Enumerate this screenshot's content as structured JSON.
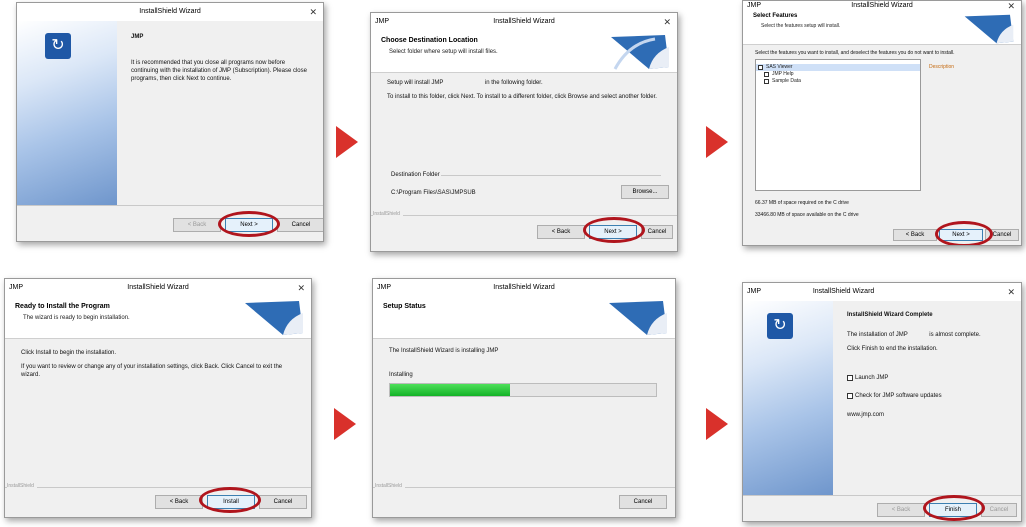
{
  "accent_color": "#d9312b",
  "highlight_color": "#b0151d",
  "progress_fraction": 0.45,
  "dialog1": {
    "title": "InstallShield Wizard",
    "product": "JMP",
    "text": "It is recommended that you close all programs now before continuing with the installation of JMP (Subscription). Please close programs, then click Next to continue.",
    "back": "< Back",
    "next": "Next >",
    "cancel": "Cancel"
  },
  "dialog2": {
    "app": "JMP",
    "title": "InstallShield Wizard",
    "header_title": "Choose Destination Location",
    "header_sub": "Select folder where setup will install files.",
    "line1": "Setup will install JMP",
    "line1b": "in the following folder.",
    "line2": "To install to this folder, click Next. To install to a different folder, click Browse and select another folder.",
    "dest_label": "Destination Folder",
    "dest_path": "C:\\Program Files\\SAS\\JMPSUB",
    "browse": "Browse...",
    "footer": "InstallShield",
    "back": "< Back",
    "next": "Next >",
    "cancel": "Cancel"
  },
  "dialog3": {
    "app": "JMP",
    "title": "InstallShield Wizard",
    "header_title": "Select Features",
    "header_sub": "Select the features setup will install.",
    "instruction": "Select the features you want to install, and deselect the features you do not want to install.",
    "description_label": "Description",
    "features": [
      "SAS Viewer",
      "JMP Help",
      "Sample Data"
    ],
    "space_required": "66.37 MB of space required on the C drive",
    "space_available": "33466.80 MB of space available on the C drive",
    "back": "< Back",
    "next": "Next >",
    "cancel": "Cancel"
  },
  "dialog4": {
    "app": "JMP",
    "title": "InstallShield Wizard",
    "header_title": "Ready to Install the Program",
    "header_sub": "The wizard is ready to begin installation.",
    "line1": "Click Install to begin the installation.",
    "line2": "If you want to review or change any of your installation settings, click Back. Click Cancel to exit the wizard.",
    "footer": "InstallShield",
    "back": "< Back",
    "install": "Install",
    "cancel": "Cancel"
  },
  "dialog5": {
    "app": "JMP",
    "title": "InstallShield Wizard",
    "header_title": "Setup Status",
    "line1": "The InstallShield Wizard is installing JMP",
    "status": "Installing",
    "footer": "InstallShield",
    "cancel": "Cancel"
  },
  "dialog6": {
    "app": "JMP",
    "title": "InstallShield Wizard",
    "heading": "InstallShield Wizard Complete",
    "line1": "The installation of JMP",
    "line1b": "is almost complete.",
    "line2": "Click Finish to end the installation.",
    "check1": "Launch JMP",
    "check2": "Check for JMP software updates",
    "link": "www.jmp.com",
    "back": "< Back",
    "finish": "Finish",
    "cancel": "Cancel"
  }
}
